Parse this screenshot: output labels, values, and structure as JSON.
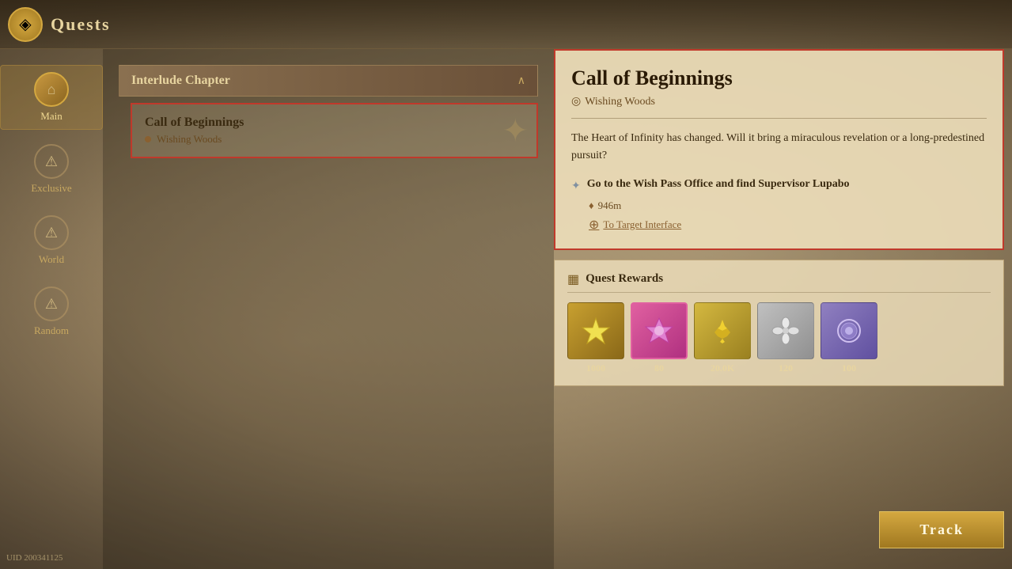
{
  "header": {
    "icon": "◈",
    "title": "Quests"
  },
  "sidebar": {
    "items": [
      {
        "id": "main",
        "label": "Main",
        "icon": "⌂",
        "active": true
      },
      {
        "id": "exclusive",
        "label": "Exclusive",
        "icon": "⚠",
        "active": false
      },
      {
        "id": "world",
        "label": "World",
        "icon": "⚠",
        "active": false
      },
      {
        "id": "random",
        "label": "Random",
        "icon": "⚠",
        "active": false
      }
    ]
  },
  "quest_list": {
    "chapter": {
      "title": "Interlude Chapter",
      "arrow": "∧"
    },
    "quests": [
      {
        "name": "Call of Beginnings",
        "location": "Wishing Woods",
        "active": true
      }
    ]
  },
  "detail": {
    "title": "Call of Beginnings",
    "location": "Wishing Woods",
    "location_icon": "◎",
    "description": "The Heart of Infinity has changed. Will it bring a miraculous revelation or a long-predestined pursuit?",
    "objective": {
      "icon": "✦",
      "text": "Go to the Wish Pass Office and find Supervisor Lupabo"
    },
    "distance": "946m",
    "nav_link": "To Target Interface"
  },
  "rewards": {
    "title": "Quest Rewards",
    "icon": "▦",
    "items": [
      {
        "type": "yellow",
        "icon": "✦",
        "count": "1000"
      },
      {
        "type": "pink",
        "icon": "💎",
        "count": "80"
      },
      {
        "type": "gold",
        "icon": "✿",
        "count": "20.0K"
      },
      {
        "type": "gray",
        "icon": "❋",
        "count": "120"
      },
      {
        "type": "purple",
        "icon": "○",
        "count": "100"
      }
    ]
  },
  "track_button": "Track",
  "uid": "UID 200341125"
}
